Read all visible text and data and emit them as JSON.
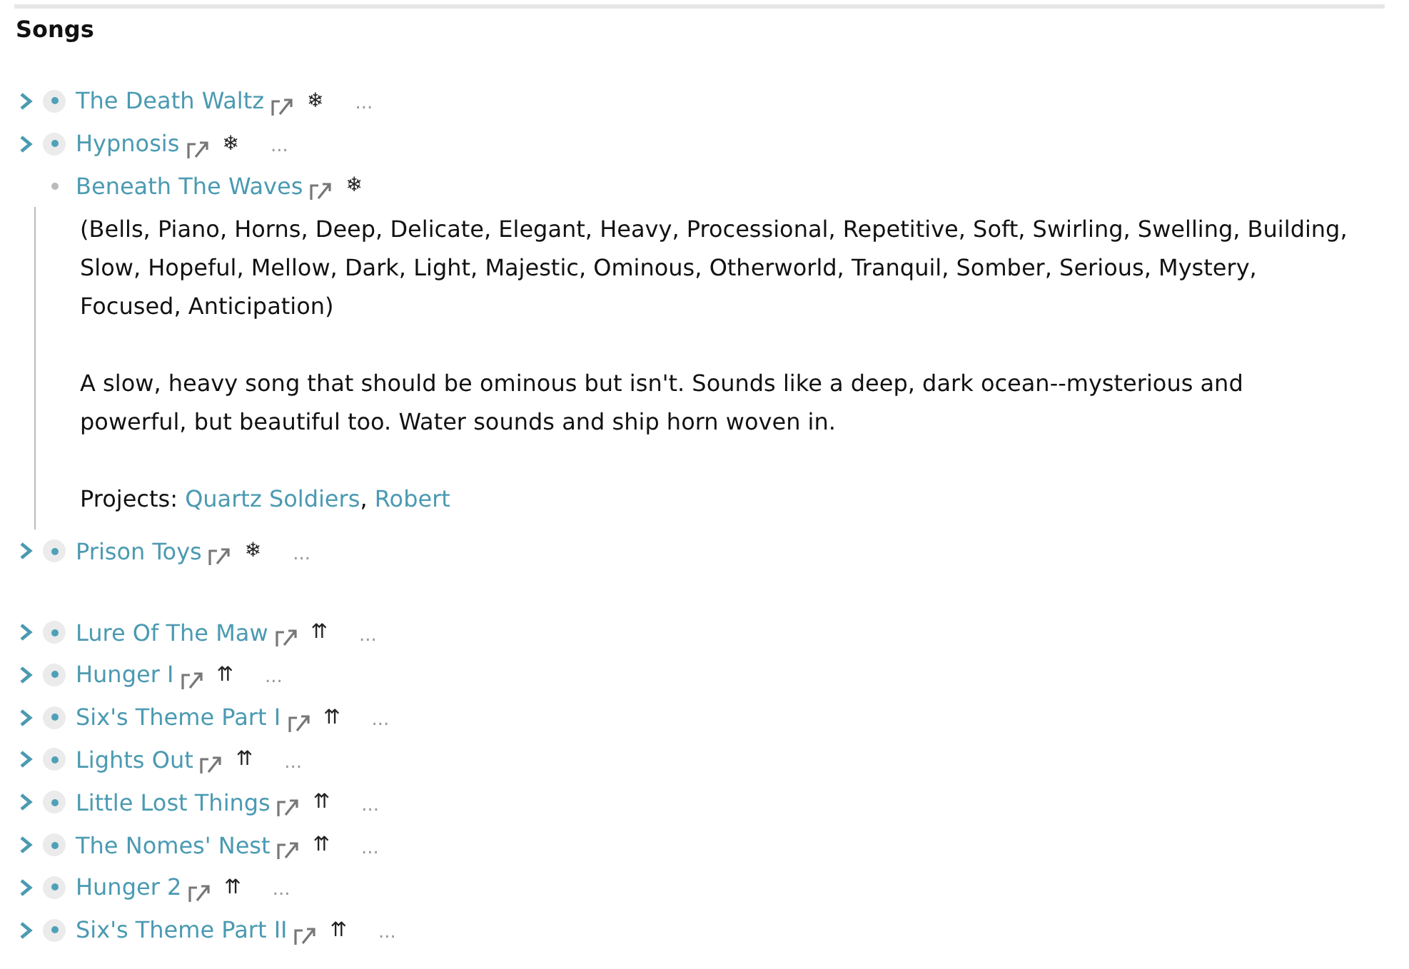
{
  "title": "Songs",
  "groups": [
    {
      "songs": [
        {
          "title": "The Death Waltz",
          "marker": "❄",
          "more": "...",
          "expanded": false
        },
        {
          "title": "Hypnosis",
          "marker": "❄",
          "more": "...",
          "expanded": false
        },
        {
          "title": "Beneath The Waves",
          "marker": "❄",
          "expanded": true,
          "tags": "(Bells, Piano, Horns, Deep, Delicate, Elegant, Heavy, Processional, Repetitive, Soft, Swirling, Swelling, Building, Slow, Hopeful, Mellow, Dark, Light, Majestic, Ominous, Otherworld, Tranquil, Somber, Serious, Mystery, Focused, Anticipation)",
          "description": "A slow, heavy song that should be ominous but isn't. Sounds like a deep, dark ocean--mysterious and powerful, but beautiful too. Water sounds and ship horn woven in.",
          "projects_label": "Projects:",
          "projects": [
            "Quartz Soldiers",
            "Robert"
          ],
          "project_separator": ","
        },
        {
          "title": "Prison Toys",
          "marker": "❄",
          "more": "...",
          "expanded": false
        }
      ]
    },
    {
      "songs": [
        {
          "title": "Lure Of The Maw",
          "marker": "⇈",
          "more": "...",
          "expanded": false
        },
        {
          "title": "Hunger I",
          "marker": "⇈",
          "more": "...",
          "expanded": false
        },
        {
          "title": "Six's Theme Part I",
          "marker": "⇈",
          "more": "...",
          "expanded": false
        },
        {
          "title": "Lights Out",
          "marker": "⇈",
          "more": "...",
          "expanded": false
        },
        {
          "title": "Little Lost Things",
          "marker": "⇈",
          "more": "...",
          "expanded": false
        },
        {
          "title": "The Nomes' Nest",
          "marker": "⇈",
          "more": "...",
          "expanded": false
        },
        {
          "title": "Hunger 2",
          "marker": "⇈",
          "more": "...",
          "expanded": false
        },
        {
          "title": "Six's Theme Part II",
          "marker": "⇈",
          "more": "...",
          "expanded": false
        }
      ]
    }
  ]
}
